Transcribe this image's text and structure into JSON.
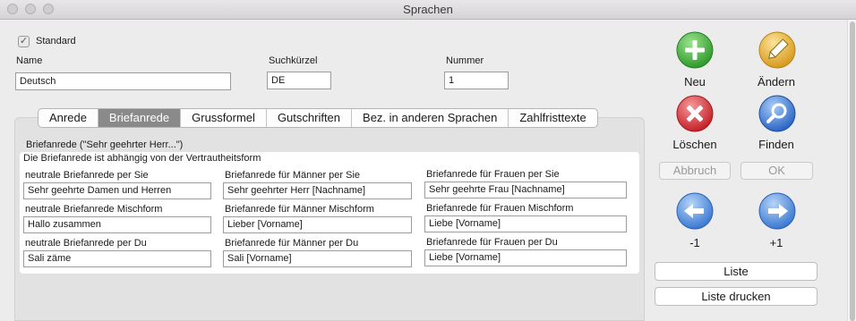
{
  "window": {
    "title": "Sprachen"
  },
  "standard": {
    "label": "Standard",
    "checked": true
  },
  "fields": {
    "name": {
      "label": "Name",
      "value": "Deutsch"
    },
    "suchkuerzel": {
      "label": "Suchkürzel",
      "value": "DE"
    },
    "nummer": {
      "label": "Nummer",
      "value": "1"
    }
  },
  "tabs": [
    {
      "label": "Anrede"
    },
    {
      "label": "Briefanrede"
    },
    {
      "label": "Grussformel"
    },
    {
      "label": "Gutschriften"
    },
    {
      "label": "Bez. in anderen Sprachen"
    },
    {
      "label": "Zahlfristtexte"
    }
  ],
  "active_tab": "Briefanrede",
  "group": {
    "title": "Briefanrede (\"Sehr geehrter Herr...\")",
    "subtitle": "Die Briefanrede ist abhängig von der Vertrautheitsform",
    "cells": [
      {
        "label": "neutrale Briefanrede per Sie",
        "value": "Sehr geehrte Damen und Herren"
      },
      {
        "label": "Briefanrede für Männer per Sie",
        "value": "Sehr geehrter Herr [Nachname]"
      },
      {
        "label": "Briefanrede für Frauen per Sie",
        "value": "Sehr geehrte Frau [Nachname]"
      },
      {
        "label": "neutrale Briefanrede Mischform",
        "value": "Hallo zusammen"
      },
      {
        "label": "Briefanrede für Männer Mischform",
        "value": "Lieber [Vorname]"
      },
      {
        "label": "Briefanrede für Frauen Mischform",
        "value": "Liebe [Vorname]"
      },
      {
        "label": "neutrale Briefanrede per Du",
        "value": "Sali zäme"
      },
      {
        "label": "Briefanrede für Männer per Du",
        "value": "Sali [Vorname]"
      },
      {
        "label": "Briefanrede für Frauen per Du",
        "value": "Liebe [Vorname]"
      }
    ]
  },
  "actions": {
    "neu": {
      "label": "Neu",
      "icon": "plus-icon",
      "color": "#3fae3a"
    },
    "aendern": {
      "label": "Ändern",
      "icon": "pencil-icon",
      "color": "#e0a82a"
    },
    "loeschen": {
      "label": "Löschen",
      "icon": "x-icon",
      "color": "#d9343a"
    },
    "finden": {
      "label": "Finden",
      "icon": "magnifier-icon",
      "color": "#2f6fd0"
    },
    "abbruch": {
      "label": "Abbruch"
    },
    "ok": {
      "label": "OK"
    },
    "prev": {
      "label": "-1",
      "icon": "arrow-left-icon",
      "color": "#3a82dd"
    },
    "next": {
      "label": "+1",
      "icon": "arrow-right-icon",
      "color": "#3a82dd"
    },
    "liste": {
      "label": "Liste"
    },
    "liste_drucken": {
      "label": "Liste drucken"
    }
  }
}
